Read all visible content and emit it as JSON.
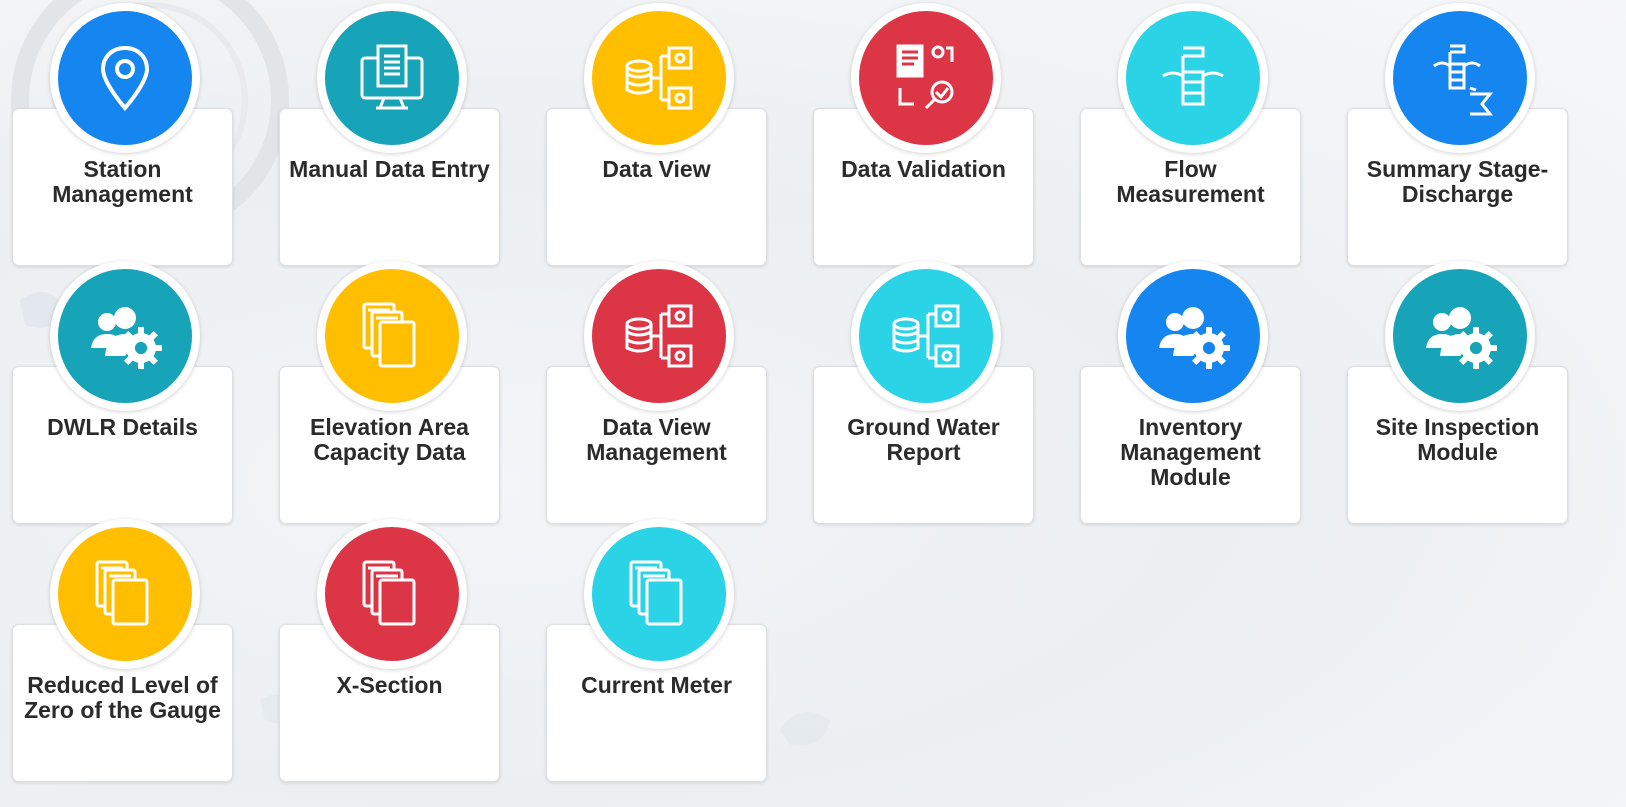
{
  "colors": {
    "blue": "#1585f0",
    "teal": "#17a3b8",
    "yellow": "#ffbf00",
    "red": "#dc3545",
    "cyan": "#2bd3e6"
  },
  "tiles": [
    {
      "label": "Station Management",
      "icon": "location-pin-icon",
      "color": "blue"
    },
    {
      "label": "Manual Data Entry",
      "icon": "data-entry-icon",
      "color": "teal"
    },
    {
      "label": "Data View",
      "icon": "database-folders-icon",
      "color": "yellow"
    },
    {
      "label": "Data Validation",
      "icon": "validation-icon",
      "color": "red"
    },
    {
      "label": "Flow Measurement",
      "icon": "flow-gauge-icon",
      "color": "cyan"
    },
    {
      "label": "Summary Stage-Discharge",
      "icon": "stage-sum-icon",
      "color": "blue"
    },
    {
      "label": "DWLR Details",
      "icon": "users-gear-icon",
      "color": "teal"
    },
    {
      "label": "Elevation Area Capacity Data",
      "icon": "stacked-files-icon",
      "color": "yellow"
    },
    {
      "label": "Data View Management",
      "icon": "database-folders-icon",
      "color": "red"
    },
    {
      "label": "Ground Water Report",
      "icon": "database-folders-icon",
      "color": "cyan"
    },
    {
      "label": "Inventory Management Module",
      "icon": "users-gear-icon",
      "color": "blue"
    },
    {
      "label": "Site Inspection Module",
      "icon": "users-gear-icon",
      "color": "teal"
    },
    {
      "label": "Reduced Level of Zero of the Gauge",
      "icon": "stacked-files-icon",
      "color": "yellow"
    },
    {
      "label": "X-Section",
      "icon": "stacked-files-icon",
      "color": "red"
    },
    {
      "label": "Current Meter",
      "icon": "stacked-files-icon",
      "color": "cyan"
    }
  ]
}
